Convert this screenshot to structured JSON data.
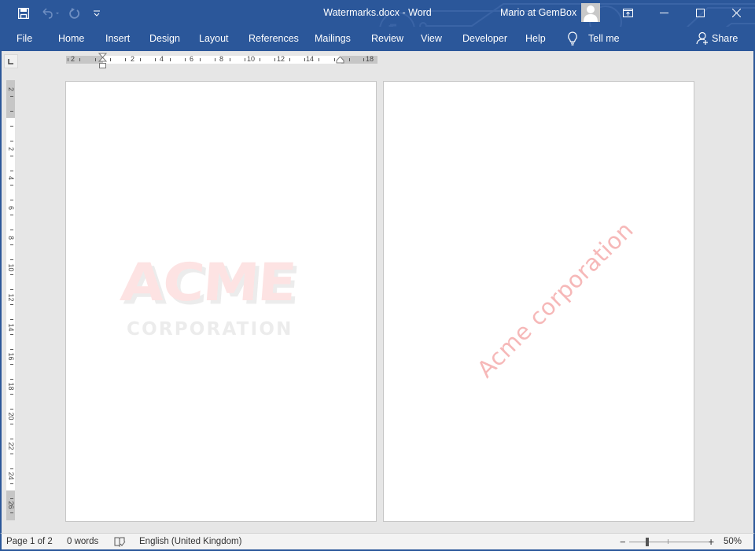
{
  "window": {
    "title": "Watermarks.docx  -  Word",
    "user": "Mario at GemBox",
    "accent": "#2b579a"
  },
  "qat": [
    {
      "icon": "save-icon"
    },
    {
      "icon": "undo-icon"
    },
    {
      "icon": "redo-icon"
    },
    {
      "icon": "customize-qat-icon"
    }
  ],
  "window_controls": [
    "ribbon-display-options-icon",
    "minimize-icon",
    "maximize-icon",
    "close-icon"
  ],
  "ribbon": {
    "tabs": [
      "File",
      "Home",
      "Insert",
      "Design",
      "Layout",
      "References",
      "Mailings",
      "Review",
      "View",
      "Developer",
      "Help"
    ],
    "tell_me": "Tell me",
    "share": "Share"
  },
  "rulers": {
    "horizontal_labels": [
      "2",
      "2",
      "4",
      "6",
      "8",
      "10",
      "12",
      "14",
      "18"
    ],
    "vertical_labels": [
      "2",
      "2",
      "4",
      "6",
      "8",
      "10",
      "12",
      "14",
      "16",
      "18",
      "20",
      "22",
      "24",
      "26"
    ]
  },
  "document": {
    "pages": [
      {
        "watermark_type": "picture",
        "watermark_line1": "ACME",
        "watermark_line2": "CORPORATION",
        "colors": {
          "main": "#fde3e3",
          "shadow": "#ececec"
        }
      },
      {
        "watermark_type": "text",
        "watermark_text": "Acme corporation",
        "color": "#f6b8b8",
        "angle_deg": -45
      }
    ]
  },
  "status": {
    "page": "Page 1 of 2",
    "words": "0 words",
    "proofing_icon": "proofing-icon",
    "language": "English (United Kingdom)",
    "zoom_minus": "−",
    "zoom_plus": "+",
    "zoom_level": "50%",
    "zoom_percent": 50
  }
}
